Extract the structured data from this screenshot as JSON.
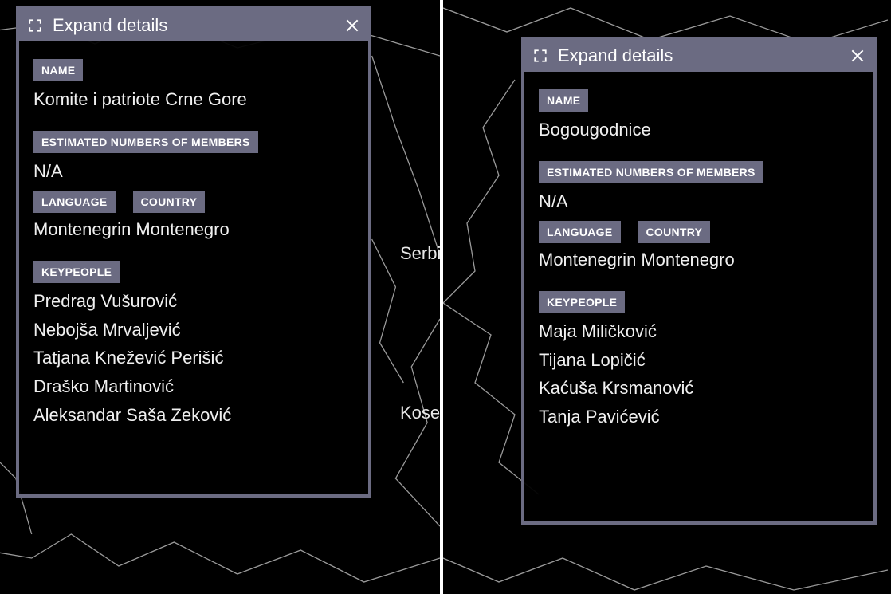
{
  "header_title": "Expand details",
  "labels": {
    "name": "NAME",
    "members": "ESTIMATED NUMBERS OF MEMBERS",
    "language": "LANGUAGE",
    "country": "COUNTRY",
    "keypeople": "KEYPEOPLE"
  },
  "map_labels": {
    "serbia": "Serbi",
    "kosovo": "Kose"
  },
  "panels": [
    {
      "name_value": "Komite i patriote Crne Gore",
      "members_value": "N/A",
      "language_value": "Montenegrin",
      "country_value": "Montenegro",
      "keypeople": [
        "Predrag Vušurović",
        "Nebojša Mrvaljević",
        "Tatjana Knežević Perišić",
        "Draško Martinović",
        "Aleksandar Saša Zeković"
      ]
    },
    {
      "name_value": "Bogougodnice",
      "members_value": "N/A",
      "language_value": "Montenegrin",
      "country_value": "Montenegro",
      "keypeople": [
        "Maja Miličković",
        "Tijana Lopičić",
        "Kaćuša Krsmanović",
        "Tanja Pavićević"
      ]
    }
  ]
}
